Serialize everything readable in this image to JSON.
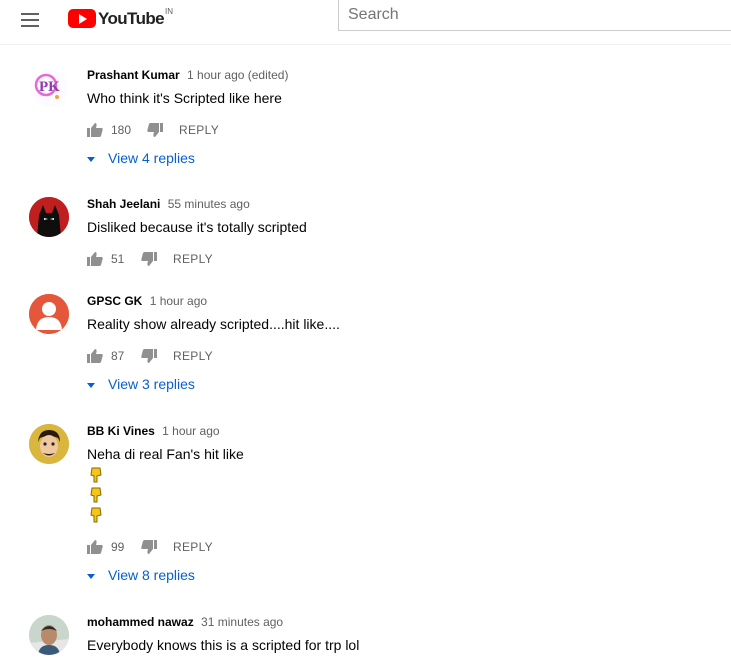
{
  "header": {
    "logo_text": "YouTube",
    "logo_country": "IN",
    "search_placeholder": "Search"
  },
  "colors": {
    "brand_red": "#ff0000",
    "link_blue": "#065fd4",
    "meta_gray": "#606060"
  },
  "comments": [
    {
      "author": "Prashant Kumar",
      "time": "1 hour ago (edited)",
      "text": "Who think it's Scripted like here",
      "likes": "180",
      "reply_label": "REPLY",
      "replies_label": "View 4 replies",
      "avatar_icon": "pk-logo-avatar"
    },
    {
      "author": "Shah Jeelani",
      "time": "55 minutes ago",
      "text": "Disliked because it's totally scripted",
      "likes": "51",
      "reply_label": "REPLY",
      "avatar_icon": "batman-avatar"
    },
    {
      "author": "GPSC GK",
      "time": "1 hour ago",
      "text": "Reality show already scripted....hit like....",
      "likes": "87",
      "reply_label": "REPLY",
      "replies_label": "View 3 replies",
      "avatar_icon": "default-person-avatar"
    },
    {
      "author": "BB Ki Vines",
      "time": "1 hour ago",
      "text": "Neha di real Fan's hit like",
      "emoji_lines": [
        "👇",
        "👇",
        "👇"
      ],
      "likes": "99",
      "reply_label": "REPLY",
      "replies_label": "View 8 replies",
      "avatar_icon": "cartoon-face-avatar"
    },
    {
      "author": "mohammed nawaz",
      "time": "31 minutes ago",
      "text": "Everybody knows this is a scripted for trp lol",
      "avatar_icon": "photo-avatar"
    }
  ]
}
